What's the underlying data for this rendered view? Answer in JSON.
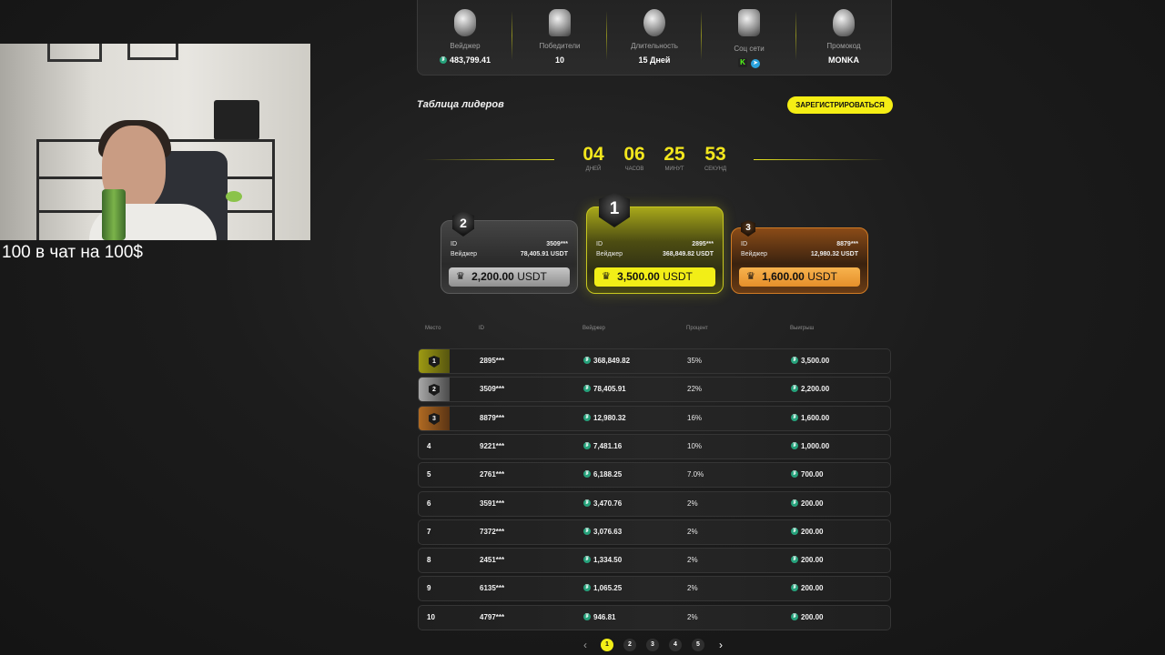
{
  "overlay": {
    "chat_caption": "100 в чат на 100$"
  },
  "stats": [
    {
      "label": "Вейджер",
      "value": "483,799.41",
      "icon": "coin-icon"
    },
    {
      "label": "Победители",
      "value": "10",
      "icon": "trophy-icon"
    },
    {
      "label": "Длительность",
      "value": "15 Дней",
      "icon": "stopwatch-icon"
    },
    {
      "label": "Соц сети",
      "value": "",
      "icon": "social-icon"
    },
    {
      "label": "Промокод",
      "value": "MONKA",
      "icon": "flame-icon"
    }
  ],
  "leaderboard": {
    "title": "Таблица лидеров",
    "register_label": "ЗАРЕГИСТРИРОВАТЬСЯ"
  },
  "countdown": {
    "days": "04",
    "days_label": "ДНЕЙ",
    "hours": "06",
    "hours_label": "ЧАСОВ",
    "minutes": "25",
    "minutes_label": "МИНУТ",
    "seconds": "53",
    "seconds_label": "СЕКУНД"
  },
  "podium": [
    {
      "place": "2",
      "id_label": "ID",
      "id": "3509***",
      "wager_label": "Вейджер",
      "wager": "78,405.91 USDT",
      "prize": "2,200.00",
      "currency": "USDT"
    },
    {
      "place": "1",
      "id_label": "ID",
      "id": "2895***",
      "wager_label": "Вейджер",
      "wager": "368,849.82 USDT",
      "prize": "3,500.00",
      "currency": "USDT"
    },
    {
      "place": "3",
      "id_label": "ID",
      "id": "8879***",
      "wager_label": "Вейджер",
      "wager": "12,980.32 USDT",
      "prize": "1,600.00",
      "currency": "USDT"
    }
  ],
  "table": {
    "headers": {
      "place": "Место",
      "id": "ID",
      "wager": "Вейджер",
      "percent": "Процент",
      "winnings": "Выигрыш"
    },
    "rows": [
      {
        "place": "1",
        "id": "2895***",
        "wager": "368,849.82",
        "percent": "35%",
        "winnings": "3,500.00"
      },
      {
        "place": "2",
        "id": "3509***",
        "wager": "78,405.91",
        "percent": "22%",
        "winnings": "2,200.00"
      },
      {
        "place": "3",
        "id": "8879***",
        "wager": "12,980.32",
        "percent": "16%",
        "winnings": "1,600.00"
      },
      {
        "place": "4",
        "id": "9221***",
        "wager": "7,481.16",
        "percent": "10%",
        "winnings": "1,000.00"
      },
      {
        "place": "5",
        "id": "2761***",
        "wager": "6,188.25",
        "percent": "7.0%",
        "winnings": "700.00"
      },
      {
        "place": "6",
        "id": "3591***",
        "wager": "3,470.76",
        "percent": "2%",
        "winnings": "200.00"
      },
      {
        "place": "7",
        "id": "7372***",
        "wager": "3,076.63",
        "percent": "2%",
        "winnings": "200.00"
      },
      {
        "place": "8",
        "id": "2451***",
        "wager": "1,334.50",
        "percent": "2%",
        "winnings": "200.00"
      },
      {
        "place": "9",
        "id": "6135***",
        "wager": "1,065.25",
        "percent": "2%",
        "winnings": "200.00"
      },
      {
        "place": "10",
        "id": "4797***",
        "wager": "946.81",
        "percent": "2%",
        "winnings": "200.00"
      }
    ]
  },
  "pagination": {
    "prev": "‹",
    "next": "›",
    "pages": [
      "1",
      "2",
      "3",
      "4",
      "5"
    ],
    "active": "1"
  },
  "colors": {
    "accent": "#f2ee17",
    "silver": "#a7a7a7",
    "bronze": "#e58f2a",
    "tether": "#26a17b"
  }
}
